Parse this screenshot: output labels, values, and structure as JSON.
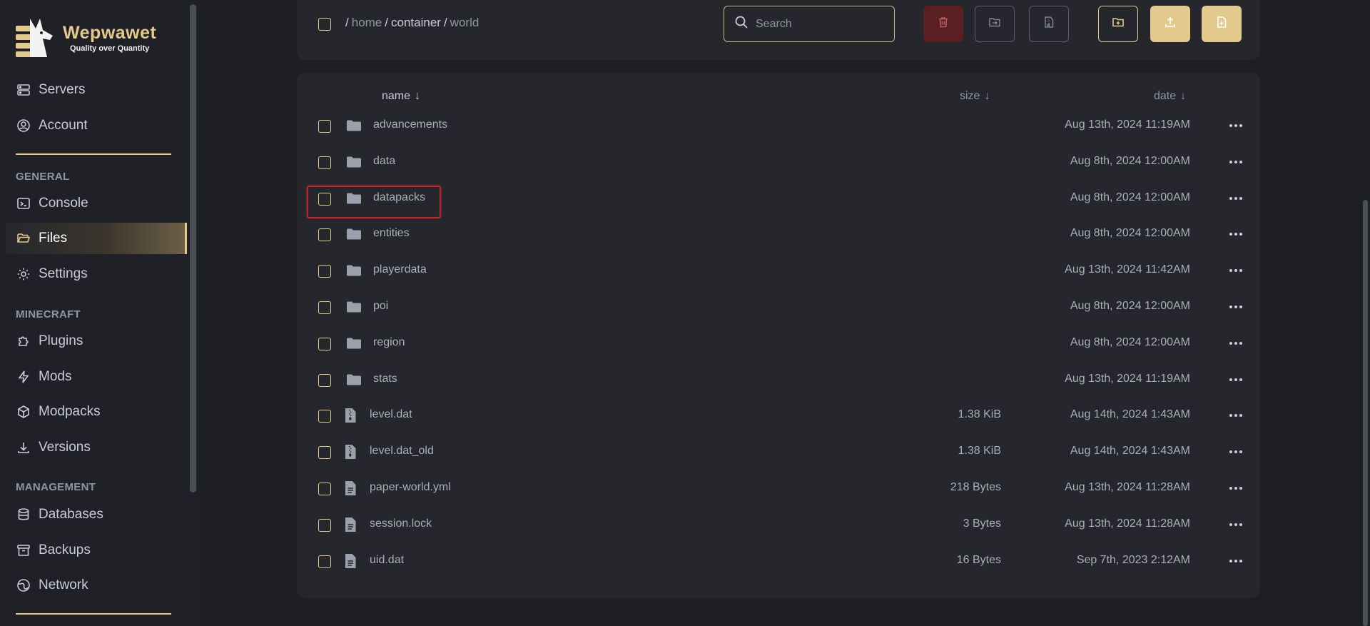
{
  "brand": {
    "name": "Wepwawet",
    "tagline": "Quality over Quantity"
  },
  "sidebar": {
    "top_items": [
      {
        "label": "Servers",
        "icon": "server-icon"
      },
      {
        "label": "Account",
        "icon": "user-circle-icon"
      }
    ],
    "sections": [
      {
        "title": "GENERAL",
        "items": [
          {
            "label": "Console",
            "icon": "terminal-icon"
          },
          {
            "label": "Files",
            "icon": "folder-open-icon",
            "active": true
          },
          {
            "label": "Settings",
            "icon": "gear-icon"
          }
        ]
      },
      {
        "title": "MINECRAFT",
        "items": [
          {
            "label": "Plugins",
            "icon": "puzzle-icon"
          },
          {
            "label": "Mods",
            "icon": "bolt-icon"
          },
          {
            "label": "Modpacks",
            "icon": "cube-icon"
          },
          {
            "label": "Versions",
            "icon": "download-icon"
          }
        ]
      },
      {
        "title": "MANAGEMENT",
        "items": [
          {
            "label": "Databases",
            "icon": "database-icon"
          },
          {
            "label": "Backups",
            "icon": "archive-icon"
          },
          {
            "label": "Network",
            "icon": "globe-icon"
          }
        ]
      }
    ]
  },
  "toolbar": {
    "breadcrumb": [
      "home",
      "container",
      "world"
    ],
    "search_placeholder": "Search",
    "buttons": [
      "delete-button",
      "move-button",
      "archive-button",
      "new-folder-button",
      "upload-button",
      "new-file-button"
    ]
  },
  "files": {
    "columns": {
      "name": "name",
      "size": "size",
      "date": "date",
      "sort_arrow": "↓"
    },
    "rows": [
      {
        "name": "advancements",
        "type": "folder",
        "size": "",
        "date": "Aug 13th, 2024 11:19AM"
      },
      {
        "name": "data",
        "type": "folder",
        "size": "",
        "date": "Aug 8th, 2024 12:00AM"
      },
      {
        "name": "datapacks",
        "type": "folder",
        "size": "",
        "date": "Aug 8th, 2024 12:00AM"
      },
      {
        "name": "entities",
        "type": "folder",
        "size": "",
        "date": "Aug 8th, 2024 12:00AM"
      },
      {
        "name": "playerdata",
        "type": "folder",
        "size": "",
        "date": "Aug 13th, 2024 11:42AM"
      },
      {
        "name": "poi",
        "type": "folder",
        "size": "",
        "date": "Aug 8th, 2024 12:00AM"
      },
      {
        "name": "region",
        "type": "folder",
        "size": "",
        "date": "Aug 8th, 2024 12:00AM"
      },
      {
        "name": "stats",
        "type": "folder",
        "size": "",
        "date": "Aug 13th, 2024 11:19AM"
      },
      {
        "name": "level.dat",
        "type": "archive",
        "size": "1.38 KiB",
        "date": "Aug 14th, 2024 1:43AM"
      },
      {
        "name": "level.dat_old",
        "type": "archive",
        "size": "1.38 KiB",
        "date": "Aug 14th, 2024 1:43AM"
      },
      {
        "name": "paper-world.yml",
        "type": "file",
        "size": "218 Bytes",
        "date": "Aug 13th, 2024 11:28AM"
      },
      {
        "name": "session.lock",
        "type": "file",
        "size": "3 Bytes",
        "date": "Aug 13th, 2024 11:28AM"
      },
      {
        "name": "uid.dat",
        "type": "file",
        "size": "16 Bytes",
        "date": "Sep 7th, 2023 2:12AM"
      }
    ]
  },
  "colors": {
    "accent": "#e3c98b",
    "danger": "#5a1f22",
    "highlight": "#c4232b",
    "background": "#1e1f23",
    "card": "#26272c"
  }
}
